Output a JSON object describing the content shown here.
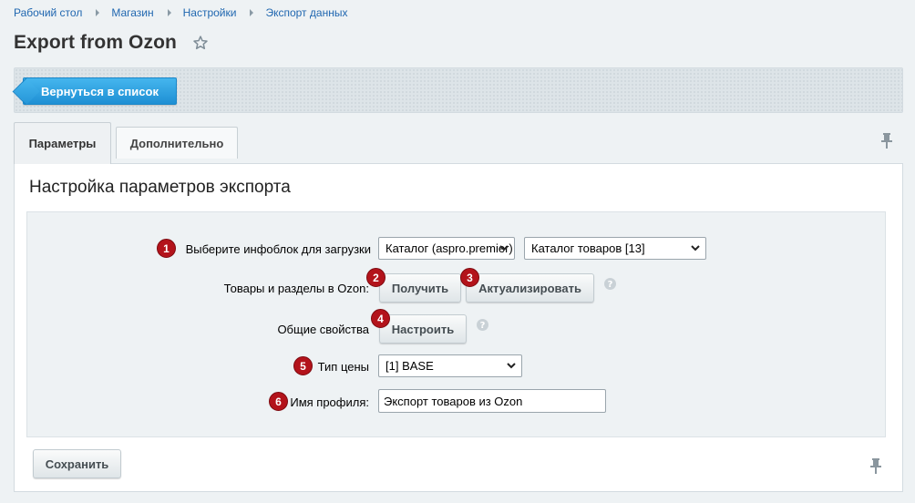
{
  "breadcrumb": [
    "Рабочий стол",
    "Магазин",
    "Настройки",
    "Экспорт данных"
  ],
  "page": {
    "title": "Export from Ozon"
  },
  "toolbar": {
    "back_label": "Вернуться в список"
  },
  "tabs": [
    {
      "label": "Параметры",
      "active": true
    },
    {
      "label": "Дополнительно",
      "active": false
    }
  ],
  "section": {
    "title": "Настройка параметров экспорта"
  },
  "form": {
    "iblock": {
      "badge": "1",
      "label": "Выберите инфоблок для загрузки",
      "select1": "Каталог (aspro.premier)",
      "select2": "Каталог товаров [13]"
    },
    "products": {
      "badge_get": "2",
      "badge_update": "3",
      "label": "Товары и разделы в Ozon:",
      "get_label": "Получить",
      "update_label": "Актуализировать"
    },
    "common": {
      "badge": "4",
      "label": "Общие свойства",
      "configure_label": "Настроить"
    },
    "price": {
      "badge": "5",
      "label": "Тип цены",
      "value": "[1] BASE"
    },
    "profile": {
      "badge": "6",
      "label": "Имя профиля:",
      "value": "Экспорт товаров из Ozon"
    }
  },
  "footer": {
    "save_label": "Сохранить"
  },
  "colors": {
    "accent": "#1e8fd4",
    "badge": "#b3131b",
    "link": "#2067b0"
  },
  "icons": {
    "star": "star-icon",
    "pin": "pin-icon",
    "help": "help-icon",
    "chevron": "chevron-down-icon"
  }
}
